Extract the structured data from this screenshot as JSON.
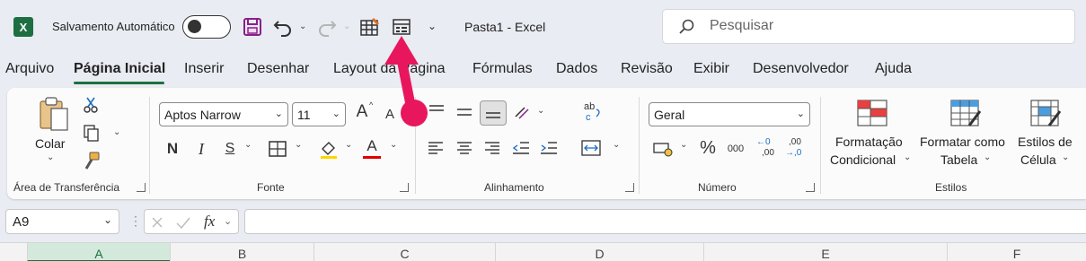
{
  "titlebar": {
    "app_logo": "X",
    "autosave_label": "Salvamento Automático",
    "autosave_on": false,
    "doc_title": "Pasta1  -  Excel",
    "search_placeholder": "Pesquisar"
  },
  "tabs": [
    "Arquivo",
    "Página Inicial",
    "Inserir",
    "Desenhar",
    "Layout da Página",
    "Fórmulas",
    "Dados",
    "Revisão",
    "Exibir",
    "Desenvolvedor",
    "Ajuda"
  ],
  "active_tab": "Página Inicial",
  "ribbon": {
    "clipboard": {
      "paste_label": "Colar",
      "group_label": "Área de Transferência"
    },
    "font": {
      "font_name": "Aptos Narrow",
      "font_size": "11",
      "bold": "N",
      "italic": "I",
      "underline": "S",
      "grow": "A",
      "shrink": "A",
      "font_color_glyph": "A",
      "group_label": "Fonte"
    },
    "alignment": {
      "group_label": "Alinhamento"
    },
    "number": {
      "format": "Geral",
      "percent": "%",
      "thousands": "000",
      "inc_decimal_top": "←0",
      "inc_decimal_bottom": ",00",
      "dec_decimal_top": ",00",
      "dec_decimal_bottom": "→,0",
      "group_label": "Número"
    },
    "styles": {
      "conditional_line1": "Formatação",
      "conditional_line2": "Condicional",
      "table_line1": "Formatar como",
      "table_line2": "Tabela",
      "cell_line1": "Estilos de",
      "cell_line2": "Célula",
      "group_label": "Estilos"
    }
  },
  "formula_bar": {
    "name_box": "A9",
    "fx": "fx",
    "formula": ""
  },
  "columns": [
    "A",
    "B",
    "C",
    "D",
    "E",
    "F"
  ],
  "selected_column": "A",
  "colors": {
    "excel_green": "#1d6f42",
    "annotation_pink": "#e8175d",
    "font_color_bar": "#e00000"
  }
}
